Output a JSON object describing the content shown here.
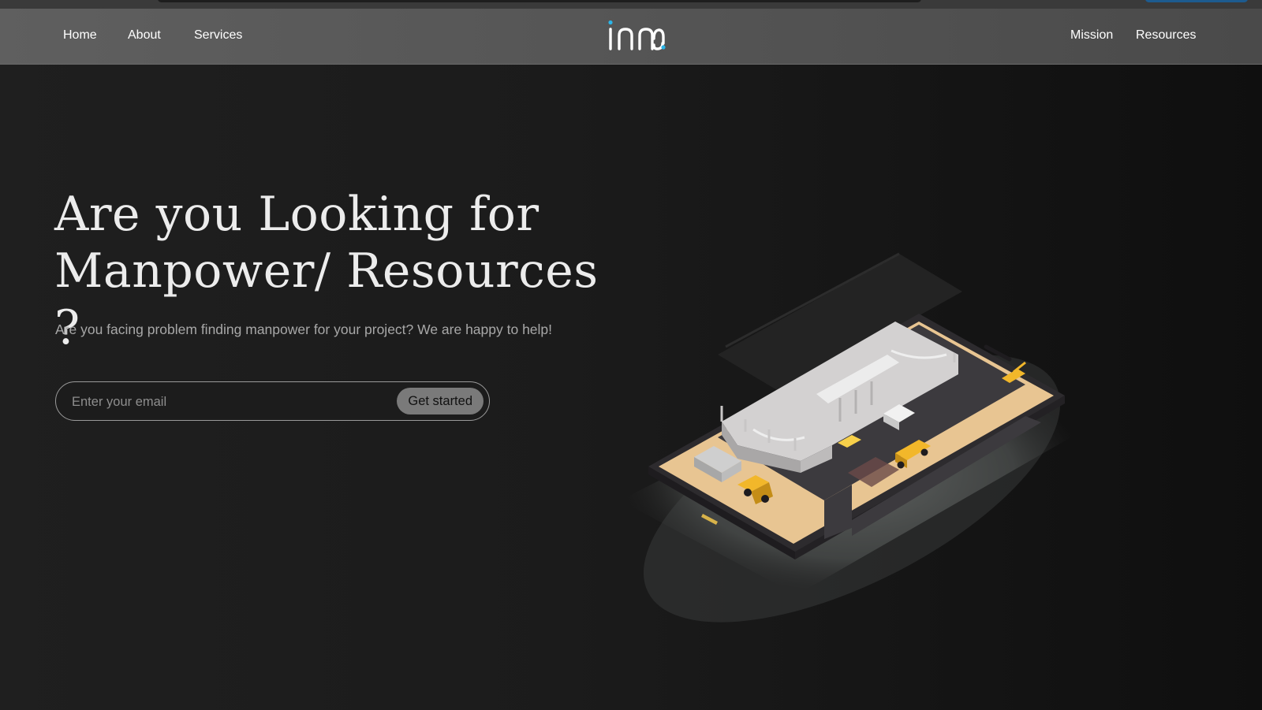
{
  "brand": {
    "logo_text": "inna",
    "accent_color": "#2bb5e8"
  },
  "nav": {
    "left": [
      "Home",
      "About",
      "Services"
    ],
    "right": [
      "Mission",
      "Resources"
    ]
  },
  "hero": {
    "title_line1": "Are you Looking for",
    "title_line2": "Manpower/ Resources ?",
    "subtitle": "Are you facing problem finding manpower for your project? We are happy to help!",
    "email_placeholder": "Enter your email",
    "email_value": "",
    "cta_label": "Get started"
  },
  "illustration": {
    "icon": "construction-site-phone-illustration",
    "colors": {
      "sand": "#e8c592",
      "asphalt": "#3c3a3e",
      "concrete": "#d3d1d1",
      "machinery": "#f2b72a"
    }
  }
}
